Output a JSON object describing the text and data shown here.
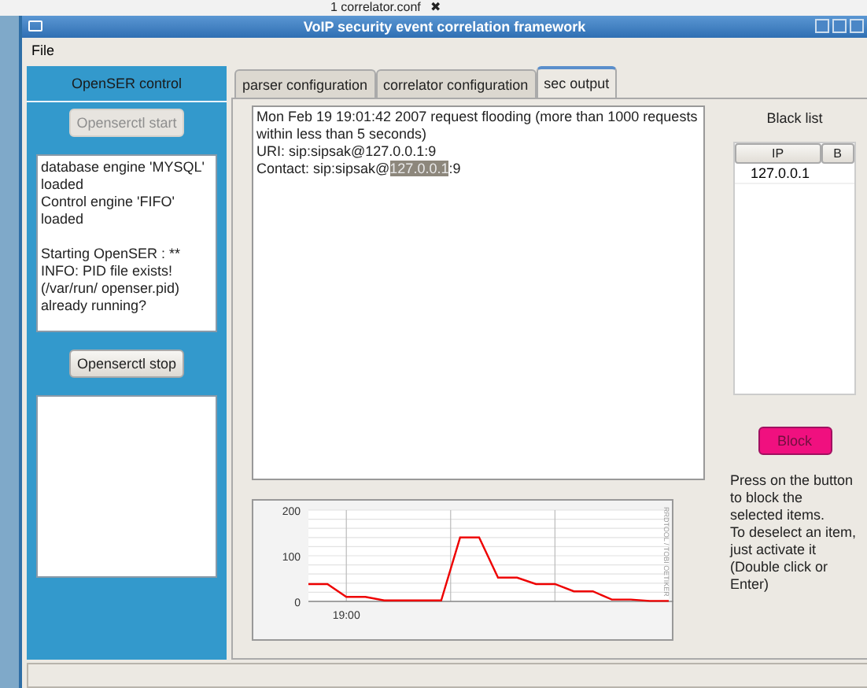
{
  "desktop_strip": {
    "label": "1 correlator.conf",
    "close": "✖"
  },
  "window": {
    "title": "VoIP security event correlation framework"
  },
  "menu": [
    "File"
  ],
  "sidebar": {
    "title": "OpenSER control",
    "start_button": {
      "label": "Openserctl start",
      "disabled": true
    },
    "log": [
      "database engine 'MYSQL' loaded\nControl engine 'FIFO' loaded",
      "Starting OpenSER : ** INFO: PID file exists! (/var/run/ openser.pid) already running?"
    ],
    "stop_button": {
      "label": "Openserctl stop",
      "disabled": false
    }
  },
  "tabs": [
    {
      "label": "parser configuration",
      "selected": false
    },
    {
      "label": "correlator configuration",
      "selected": false
    },
    {
      "label": "sec output",
      "selected": true
    }
  ],
  "output": [
    {
      "text": "Mon Feb 19 19:01:42 2007 request flooding (more than 1000 requests within less than 5 seconds)"
    },
    {
      "text": "URI: sip:sipsak@127.0.0.1:9"
    },
    {
      "text": "Contact: sip:sipsak@",
      "selection": "127.0.0.1",
      "rest": ":9"
    }
  ],
  "chart": {
    "credit": "RRDTOOL / TOBI OETIKER",
    "chart_data": {
      "type": "line",
      "categories": [
        null,
        null,
        "19:00",
        null,
        null,
        null,
        null,
        null,
        null,
        null,
        null,
        null,
        null,
        null,
        null,
        null,
        null,
        null,
        null,
        null
      ],
      "series": [
        {
          "color": "#ee0000",
          "values": [
            38,
            38,
            10,
            10,
            2,
            2,
            2,
            2,
            140,
            140,
            52,
            52,
            38,
            38,
            22,
            22,
            4,
            4,
            1,
            1
          ]
        }
      ],
      "ylim": [
        0,
        200
      ],
      "yticks": [
        0,
        100,
        200
      ]
    }
  },
  "blacklist": {
    "title": "Black list",
    "columns": [
      "IP",
      "B"
    ],
    "rows": [
      {
        "ip": "127.0.0.1",
        "selected": false
      }
    ],
    "block_button": "Block",
    "help": "Press on the button to block the selected items.\nTo deselect an item, just activate it (Double click or Enter)"
  }
}
